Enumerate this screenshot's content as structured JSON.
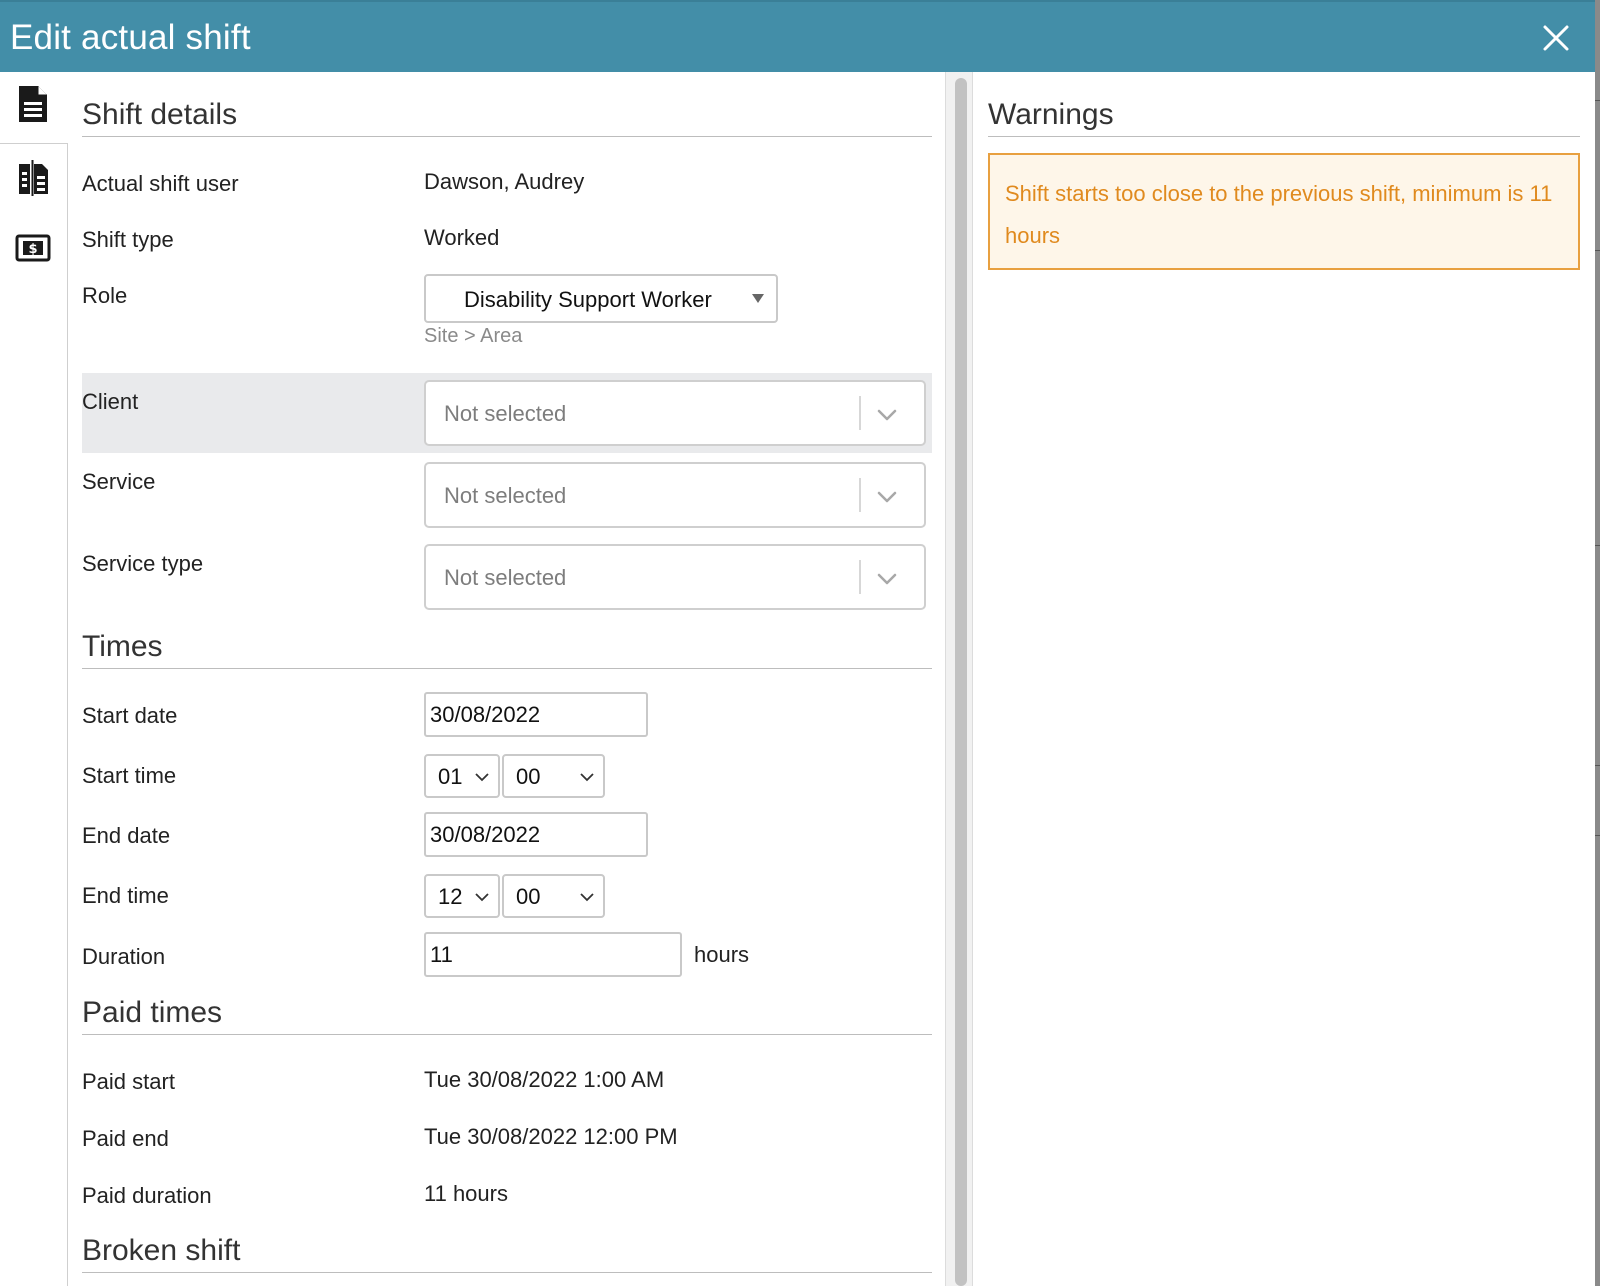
{
  "dialog": {
    "title": "Edit actual shift",
    "close_icon": "close-icon"
  },
  "rail": {
    "items": [
      {
        "icon": "document-icon",
        "active": true
      },
      {
        "icon": "split-document-icon",
        "active": false
      },
      {
        "icon": "money-icon",
        "active": false
      }
    ]
  },
  "shift_details": {
    "heading": "Shift details",
    "user_label": "Actual shift user",
    "user_value": "Dawson, Audrey",
    "type_label": "Shift type",
    "type_value": "Worked",
    "role_label": "Role",
    "role_value": "Disability Support Worker",
    "role_hint": "Site > Area",
    "client_label": "Client",
    "client_value": "Not selected",
    "service_label": "Service",
    "service_value": "Not selected",
    "service_type_label": "Service type",
    "service_type_value": "Not selected"
  },
  "times": {
    "heading": "Times",
    "start_date_label": "Start date",
    "start_date_value": "30/08/2022",
    "start_time_label": "Start time",
    "start_hour": "01",
    "start_minute": "00",
    "end_date_label": "End date",
    "end_date_value": "30/08/2022",
    "end_time_label": "End time",
    "end_hour": "12",
    "end_minute": "00",
    "duration_label": "Duration",
    "duration_value": "11",
    "duration_unit": "hours"
  },
  "paid_times": {
    "heading": "Paid times",
    "start_label": "Paid start",
    "start_value": "Tue 30/08/2022 1:00 AM",
    "end_label": "Paid end",
    "end_value": "Tue 30/08/2022 12:00 PM",
    "duration_label": "Paid duration",
    "duration_value": "11 hours"
  },
  "broken_shift": {
    "heading": "Broken shift"
  },
  "warnings": {
    "heading": "Warnings",
    "message": "Shift starts too close to the previous shift, minimum is 11 hours",
    "border_color": "#e8a040",
    "text_color": "#e08a1e"
  },
  "colors": {
    "titlebar": "#438ea8"
  }
}
